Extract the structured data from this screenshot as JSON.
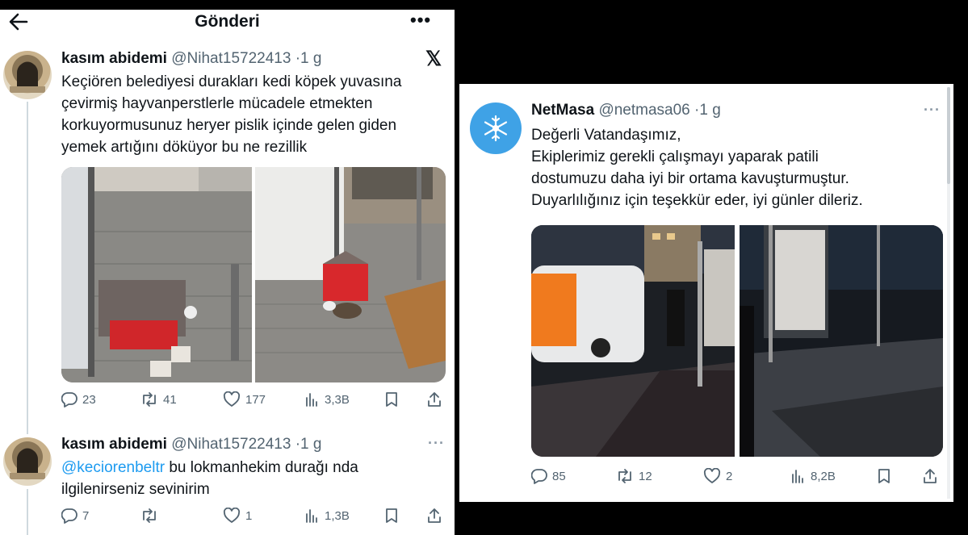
{
  "header": {
    "title": "Gönderi"
  },
  "tweet1": {
    "name": "kasım abidemi",
    "handle": "@Nihat15722413",
    "time": "·1 g",
    "lines": [
      "Keçiören belediyesi durakları kedi köpek yuvasına",
      "çevirmiş hayvanperstlerle mücadele etmekten",
      "korkuyormusunuz heryer pislik içinde gelen giden",
      "yemek artığını döküyor bu ne rezillik"
    ],
    "stats": {
      "replies": "23",
      "reposts": "41",
      "likes": "177",
      "views": "3,3B"
    }
  },
  "tweet2": {
    "name": "kasım abidemi",
    "handle": "@Nihat15722413",
    "time": "·1 g",
    "mention": "@keciorenbeltr",
    "line1_rest": " bu lokmanhekim durağı nda",
    "line2": "ilgilenirseniz sevinirim",
    "stats": {
      "replies": "7",
      "reposts": "",
      "likes": "1",
      "views": "1,3B"
    }
  },
  "tweet3": {
    "name": "NetMasa",
    "handle": "@netmasa06",
    "time": "·1 g",
    "lines": [
      "Değerli Vatandaşımız,",
      "Ekiplerimiz gerekli çalışmayı yaparak patili",
      "dostumuzu daha iyi bir ortama kavuşturmuştur.",
      "Duyarlılığınız için teşekkür eder, iyi günler dileriz."
    ],
    "stats": {
      "replies": "85",
      "reposts": "12",
      "likes": "2",
      "views": "8,2B"
    }
  },
  "icons": {
    "back": "arrow-left-icon",
    "more": "more-dots-icon",
    "x": "x-logo-icon",
    "reply": "reply-icon",
    "repost": "repost-icon",
    "like": "heart-icon",
    "views": "views-icon",
    "bookmark": "bookmark-icon",
    "share": "share-icon"
  },
  "colors": {
    "mention": "#1d9bf0",
    "muted": "#536471",
    "netmasa_avatar": "#3fa2e6"
  }
}
